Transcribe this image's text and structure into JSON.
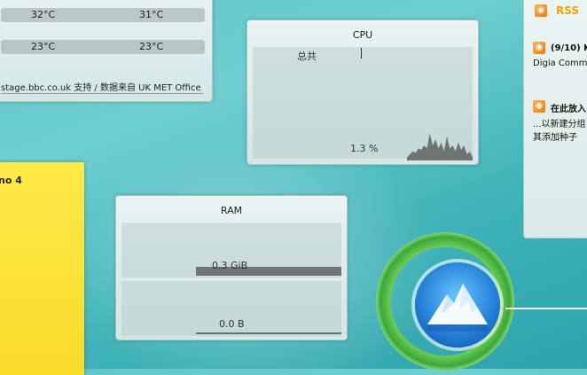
{
  "weather": {
    "row1_high": "32°C",
    "row1_low": "31°C",
    "row2_high": "23°C",
    "row2_low": "23°C",
    "source": "stage.bbc.co.uk 支持 / 数据来自 UK MET Office"
  },
  "cpu": {
    "title": "CPU",
    "label": "总共",
    "percent_text": "1.3 %",
    "load_history": [
      0.1,
      0.2,
      0.3,
      0.25,
      0.4,
      0.35,
      0.5,
      0.4,
      0.9,
      0.5,
      0.7,
      0.4,
      0.6,
      0.3,
      0.8,
      0.4,
      0.5,
      0.3,
      0.6,
      0.35,
      0.5,
      0.2,
      0.3,
      0.1
    ]
  },
  "ram": {
    "title": "RAM",
    "used_text": "0.3 GiB",
    "swap_text": "0.0 B"
  },
  "note": {
    "title": "no 4"
  },
  "rss": {
    "header": "RSS",
    "item1_title": "(9/10) K",
    "item1_sub": "Digia Commit",
    "item2_title": "在此放入",
    "item2_line1": "...以新建分组",
    "item2_line2": "其添加种子"
  },
  "colors": {
    "accent": "#3aa83a",
    "desktop": "#5fc4c6",
    "note": "#ffe94a"
  }
}
